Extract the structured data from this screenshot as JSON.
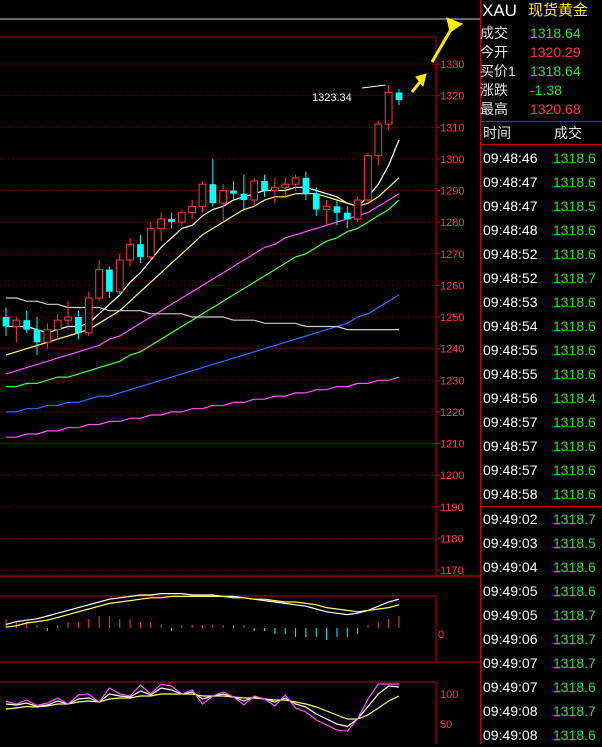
{
  "header": {
    "symbol": "XAU",
    "name": "现货黄金",
    "rows": [
      {
        "label": "成交",
        "value": "1318.64",
        "color": "#2ede2e"
      },
      {
        "label": "今开",
        "value": "1320.29",
        "color": "#ff3b3b"
      },
      {
        "label": "买价1",
        "value": "1318.64",
        "color": "#2ede2e"
      },
      {
        "label": "涨跌",
        "value": "-1.38",
        "color": "#2ede2e"
      },
      {
        "label": "最高",
        "value": "1320.68",
        "color": "#ff3b3b"
      }
    ]
  },
  "ticks_header": {
    "time": "时间",
    "price": "成交"
  },
  "ticks": [
    {
      "time": "09:48:46",
      "price": "1318.6"
    },
    {
      "time": "09:48:47",
      "price": "1318.6"
    },
    {
      "time": "09:48:47",
      "price": "1318.5"
    },
    {
      "time": "09:48:48",
      "price": "1318.6"
    },
    {
      "time": "09:48:52",
      "price": "1318.6"
    },
    {
      "time": "09:48:52",
      "price": "1318.7"
    },
    {
      "time": "09:48:53",
      "price": "1318.6"
    },
    {
      "time": "09:48:54",
      "price": "1318.6"
    },
    {
      "time": "09:48:55",
      "price": "1318.6"
    },
    {
      "time": "09:48:55",
      "price": "1318.6"
    },
    {
      "time": "09:48:56",
      "price": "1318.4"
    },
    {
      "time": "09:48:57",
      "price": "1318.6"
    },
    {
      "time": "09:48:57",
      "price": "1318.6"
    },
    {
      "time": "09:48:57",
      "price": "1318.6"
    },
    {
      "time": "09:48:58",
      "price": "1318.6"
    },
    {
      "time": "09:49:02",
      "price": "1318.7"
    },
    {
      "time": "09:49:03",
      "price": "1318.5"
    },
    {
      "time": "09:49:04",
      "price": "1318.6"
    },
    {
      "time": "09:49:05",
      "price": "1318.6"
    },
    {
      "time": "09:49:05",
      "price": "1318.7"
    },
    {
      "time": "09:49:06",
      "price": "1318.7"
    },
    {
      "time": "09:49:07",
      "price": "1318.7"
    },
    {
      "time": "09:49:07",
      "price": "1318.6"
    },
    {
      "time": "09:49:08",
      "price": "1318.7"
    },
    {
      "time": "09:49:08",
      "price": "1318.6"
    }
  ],
  "chart": {
    "price_axis": [
      "1330",
      "1320",
      "1310",
      "1300",
      "1290",
      "1280",
      "1270",
      "1260",
      "1250",
      "1240",
      "1230",
      "1220",
      "1210",
      "1200",
      "1190",
      "1180",
      "1170"
    ],
    "price_axis_range": [
      1170,
      1330
    ],
    "high_label": "1323.34",
    "macd_zero_label": "0",
    "kdj_labels": [
      "100",
      "50"
    ],
    "up_color": "#ff3b3b",
    "down_color": "#00ffff",
    "candles": [
      [
        1250,
        1253,
        1244,
        1247
      ],
      [
        1247,
        1250,
        1242,
        1249
      ],
      [
        1249,
        1252,
        1245,
        1246
      ],
      [
        1246,
        1250,
        1238,
        1242
      ],
      [
        1242,
        1248,
        1240,
        1246
      ],
      [
        1246,
        1251,
        1243,
        1249
      ],
      [
        1249,
        1255,
        1246,
        1250
      ],
      [
        1250,
        1252,
        1243,
        1245
      ],
      [
        1245,
        1258,
        1244,
        1256
      ],
      [
        1256,
        1268,
        1255,
        1265
      ],
      [
        1265,
        1266,
        1256,
        1258
      ],
      [
        1258,
        1270,
        1257,
        1268
      ],
      [
        1268,
        1275,
        1266,
        1273
      ],
      [
        1273,
        1276,
        1267,
        1269
      ],
      [
        1269,
        1280,
        1268,
        1278
      ],
      [
        1278,
        1283,
        1274,
        1281
      ],
      [
        1281,
        1283,
        1278,
        1280
      ],
      [
        1280,
        1284,
        1279,
        1283
      ],
      [
        1283,
        1287,
        1281,
        1285
      ],
      [
        1285,
        1293,
        1283,
        1292
      ],
      [
        1292,
        1300,
        1285,
        1286
      ],
      [
        1286,
        1292,
        1280,
        1290
      ],
      [
        1290,
        1293,
        1287,
        1289
      ],
      [
        1289,
        1295,
        1284,
        1287
      ],
      [
        1287,
        1294,
        1285,
        1293
      ],
      [
        1293,
        1295,
        1288,
        1290
      ],
      [
        1290,
        1294,
        1286,
        1291
      ],
      [
        1291,
        1294,
        1288,
        1292
      ],
      [
        1292,
        1295,
        1290,
        1294
      ],
      [
        1294,
        1296,
        1287,
        1289
      ],
      [
        1289,
        1291,
        1282,
        1284
      ],
      [
        1284,
        1287,
        1279,
        1285
      ],
      [
        1285,
        1287,
        1279,
        1283
      ],
      [
        1283,
        1285,
        1278,
        1281
      ],
      [
        1281,
        1288,
        1280,
        1287
      ],
      [
        1287,
        1302,
        1286,
        1301
      ],
      [
        1301,
        1312,
        1298,
        1311
      ],
      [
        1311,
        1323.34,
        1309,
        1321
      ],
      [
        1321,
        1322,
        1317,
        1318.64
      ]
    ],
    "ma": [
      {
        "color": "#ffffff",
        "values": [
          1247,
          1247,
          1247,
          1246,
          1245,
          1246,
          1247,
          1247,
          1248,
          1251,
          1254,
          1257,
          1261,
          1264,
          1268,
          1272,
          1275,
          1278,
          1279,
          1282,
          1284,
          1285,
          1287,
          1288,
          1289,
          1290,
          1290,
          1290,
          1291,
          1291,
          1290,
          1289,
          1288,
          1286,
          1285,
          1288,
          1292,
          1298,
          1306
        ]
      },
      {
        "color": "#ffff66",
        "values": [
          1238,
          1239,
          1240,
          1241,
          1242,
          1243,
          1244,
          1245,
          1246,
          1248,
          1250,
          1252,
          1255,
          1258,
          1261,
          1264,
          1267,
          1270,
          1273,
          1276,
          1278,
          1280,
          1282,
          1284,
          1285,
          1287,
          1288,
          1288,
          1289,
          1289,
          1289,
          1288,
          1287,
          1286,
          1285,
          1286,
          1288,
          1291,
          1294
        ]
      },
      {
        "color": "#ff55ff",
        "values": [
          1232,
          1233,
          1234,
          1235,
          1236,
          1237,
          1238,
          1239,
          1240,
          1241,
          1243,
          1244,
          1246,
          1248,
          1250,
          1252,
          1254,
          1256,
          1258,
          1260,
          1262,
          1264,
          1266,
          1268,
          1270,
          1272,
          1273,
          1275,
          1276,
          1277,
          1278,
          1279,
          1280,
          1281,
          1282,
          1283,
          1285,
          1287,
          1289
        ]
      },
      {
        "color": "#44ff44",
        "values": [
          1228,
          1228,
          1229,
          1229,
          1230,
          1231,
          1231,
          1232,
          1233,
          1234,
          1235,
          1236,
          1238,
          1239,
          1241,
          1243,
          1245,
          1247,
          1249,
          1251,
          1253,
          1255,
          1257,
          1259,
          1261,
          1263,
          1265,
          1267,
          1269,
          1270,
          1272,
          1274,
          1275,
          1277,
          1278,
          1280,
          1282,
          1284,
          1287
        ]
      },
      {
        "color": "#2f6bff",
        "values": [
          1220,
          1220,
          1221,
          1221,
          1222,
          1222,
          1223,
          1223,
          1224,
          1225,
          1225,
          1226,
          1227,
          1228,
          1229,
          1230,
          1231,
          1232,
          1233,
          1234,
          1235,
          1236,
          1237,
          1238,
          1239,
          1240,
          1241,
          1242,
          1243,
          1244,
          1245,
          1246,
          1247,
          1248,
          1250,
          1251,
          1253,
          1255,
          1257
        ]
      },
      {
        "color": "#cccccc",
        "values": [
          1256,
          1256,
          1255,
          1255,
          1254,
          1254,
          1253,
          1253,
          1253,
          1253,
          1252,
          1252,
          1252,
          1252,
          1251,
          1251,
          1251,
          1251,
          1250,
          1250,
          1250,
          1250,
          1249,
          1249,
          1249,
          1248,
          1248,
          1248,
          1248,
          1247,
          1247,
          1247,
          1247,
          1246,
          1246,
          1246,
          1246,
          1246,
          1246
        ]
      },
      {
        "color": "#ff55ff",
        "values": [
          1212,
          1212,
          1213,
          1213,
          1214,
          1214,
          1215,
          1215,
          1216,
          1216,
          1217,
          1217,
          1218,
          1218,
          1219,
          1219,
          1220,
          1220,
          1221,
          1221,
          1222,
          1222,
          1223,
          1223,
          1224,
          1224,
          1225,
          1225,
          1226,
          1226,
          1227,
          1227,
          1228,
          1228,
          1229,
          1229,
          1230,
          1230,
          1231
        ]
      }
    ],
    "macd_dif": [
      -6,
      -4,
      -3,
      -2,
      0,
      2,
      4,
      6,
      8,
      10,
      12,
      13,
      14,
      15,
      15,
      16,
      16,
      16,
      15,
      15,
      15,
      14,
      14,
      13,
      12,
      11,
      10,
      9,
      8,
      7,
      5,
      3,
      2,
      1,
      2,
      4,
      7,
      10,
      12
    ],
    "macd_dea": [
      -8,
      -7,
      -5,
      -4,
      -3,
      -1,
      1,
      3,
      5,
      7,
      9,
      10,
      11,
      12,
      13,
      13,
      14,
      14,
      14,
      14,
      14,
      14,
      13,
      13,
      12,
      12,
      11,
      10,
      10,
      9,
      8,
      6,
      5,
      4,
      3,
      4,
      5,
      6,
      8
    ],
    "macd_bars": [
      3,
      2,
      2,
      1,
      -1,
      1,
      2,
      2,
      3,
      4,
      4,
      3,
      3,
      2,
      2,
      1,
      -1,
      1,
      1,
      1,
      1,
      1,
      1,
      1,
      -1,
      -1,
      -2,
      -2,
      -3,
      -3,
      -3,
      -4,
      -3,
      -3,
      -2,
      1,
      2,
      3,
      4
    ],
    "kdj_k": [
      60,
      58,
      62,
      55,
      58,
      66,
      60,
      70,
      72,
      64,
      80,
      76,
      74,
      86,
      78,
      92,
      88,
      80,
      84,
      70,
      76,
      80,
      74,
      66,
      74,
      70,
      64,
      72,
      60,
      54,
      40,
      30,
      20,
      15,
      30,
      55,
      80,
      96,
      94
    ],
    "kdj_d": [
      50,
      52,
      55,
      54,
      56,
      60,
      60,
      64,
      66,
      64,
      70,
      72,
      72,
      76,
      76,
      80,
      80,
      80,
      80,
      76,
      76,
      76,
      74,
      72,
      72,
      70,
      68,
      68,
      64,
      60,
      54,
      46,
      38,
      30,
      30,
      38,
      52,
      66,
      76
    ],
    "kdj_j": [
      65,
      60,
      68,
      57,
      62,
      72,
      60,
      78,
      80,
      64,
      92,
      80,
      76,
      98,
      80,
      100,
      96,
      80,
      88,
      60,
      76,
      84,
      74,
      58,
      76,
      70,
      56,
      78,
      52,
      44,
      28,
      18,
      8,
      6,
      30,
      70,
      100,
      100,
      100
    ]
  }
}
